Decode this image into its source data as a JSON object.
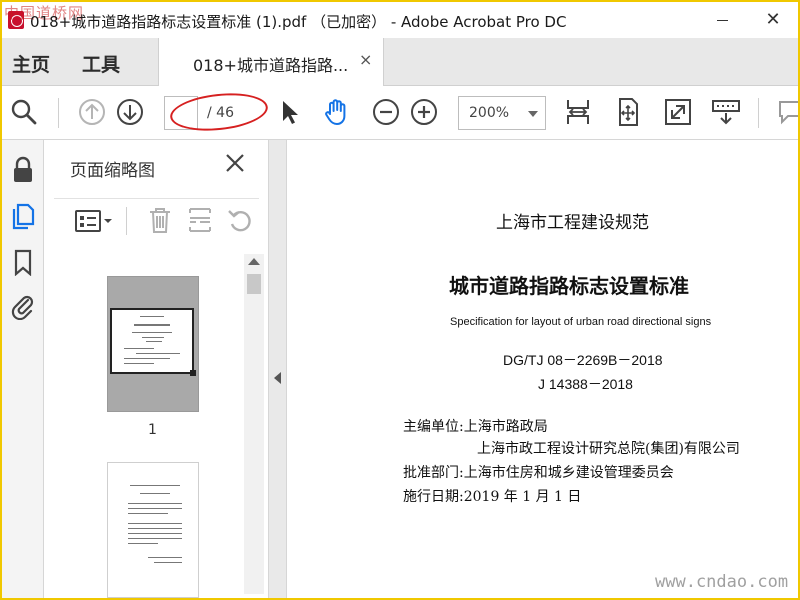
{
  "window": {
    "title": "018+城市道路指路标志设置标准 (1).pdf （已加密） - Adobe Acrobat Pro DC",
    "minimize_glyph": "—",
    "close_glyph": "✕"
  },
  "watermarks": {
    "top_left": "中国道桥网",
    "bottom_right": "www.cndao.com"
  },
  "tabs": {
    "home_label": "主页",
    "tools_label": "工具",
    "document_label": "018+城市道路指路...",
    "document_close": "×"
  },
  "toolbar": {
    "page_current": "",
    "page_total": "/ 46",
    "zoom_value": "200%",
    "highlight_color": "#d62020",
    "active_icon_color": "#1473e6",
    "icons": [
      "search-icon",
      "page-up-icon",
      "page-down-icon",
      "select-pointer-icon",
      "hand-tool-icon",
      "zoom-out-icon",
      "zoom-in-icon",
      "fit-width-icon",
      "fit-page-icon",
      "full-screen-icon",
      "read-mode-icon",
      "comment-icon"
    ]
  },
  "left_rail": {
    "icons": [
      "lock-icon",
      "page-thumbnails-icon",
      "bookmark-icon",
      "attachment-icon"
    ]
  },
  "thumbnail_panel": {
    "title": "页面缩略图",
    "close_glyph": "✕",
    "tool_icons": [
      "thumbnail-options-icon",
      "delete-icon",
      "insert-page-icon",
      "rotate-icon"
    ],
    "thumbnails": [
      {
        "page_number": "1"
      }
    ]
  },
  "document": {
    "org_line": "上海市工程建设规范",
    "title": "城市道路指路标志设置标准",
    "english_title": "Specification for layout of urban road directional signs",
    "code_1": "DG/TJ 08－2269B－2018",
    "code_2": "J 14388－2018",
    "info": [
      "主编单位:上海市路政局",
      "上海市政工程设计研究总院(集团)有限公司",
      "批准部门:上海市住房和城乡建设管理委员会",
      "施行日期:2019 年 1 月 1 日"
    ]
  }
}
